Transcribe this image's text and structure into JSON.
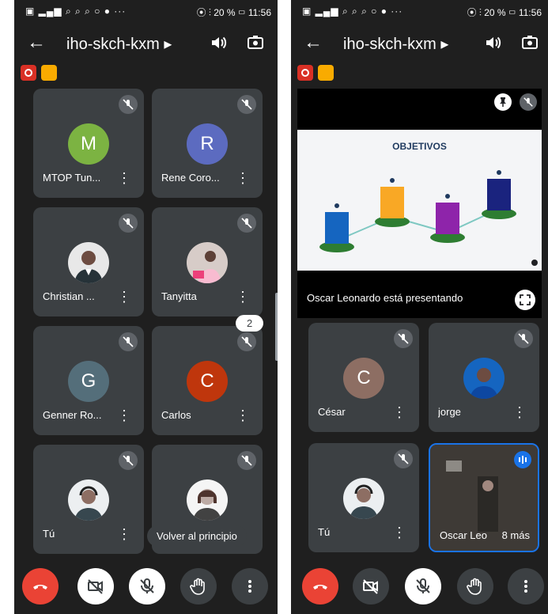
{
  "left": {
    "status": {
      "left_text": "▣ ▂▄▆ ⌕ ⌕ ⌕ ○ ● ···",
      "right_text": "⦿ ⫶ 20 % ▭ 11:56"
    },
    "meeting_code": "iho-skch-kxm ▸",
    "participants": [
      {
        "name": "MTOP Tun...",
        "initial": "M",
        "color": "#7cb342"
      },
      {
        "name": "Rene Coro...",
        "initial": "R",
        "color": "#5c6bc0"
      },
      {
        "name": "Christian ...",
        "initial": "",
        "color": ""
      },
      {
        "name": "Tanyitta",
        "initial": "",
        "color": ""
      },
      {
        "name": "Genner Ro...",
        "initial": "G",
        "color": "#546e7a"
      },
      {
        "name": "Carlos",
        "initial": "C",
        "color": "#bf360c"
      },
      {
        "name": "Tú",
        "initial": "",
        "color": ""
      },
      {
        "name": "",
        "initial": "",
        "color": ""
      }
    ],
    "page_indicator": "2",
    "back_to_top": "Volver al principio"
  },
  "right": {
    "status": {
      "left_text": "▣ ▂▄▆ ⌕ ⌕ ⌕ ○ ● ···",
      "right_text": "⦿ ⫶ 20 % ▭ 11:56"
    },
    "meeting_code": "iho-skch-kxm ▸",
    "presentation": {
      "slide_title": "OBJETIVOS",
      "caption": "Oscar Leonardo está presentando"
    },
    "participants": [
      {
        "name": "César",
        "initial": "C",
        "color": "#8d6e63"
      },
      {
        "name": "jorge",
        "initial": "",
        "color": ""
      },
      {
        "name": "Tú",
        "initial": "",
        "color": ""
      },
      {
        "name": "Oscar Leo",
        "initial": "",
        "color": ""
      }
    ],
    "more_label": "8 más"
  },
  "colors": {
    "end_call": "#ea4335",
    "tile": "#3c4043",
    "background": "#1f1f1f",
    "speaking": "#1a73e8"
  }
}
